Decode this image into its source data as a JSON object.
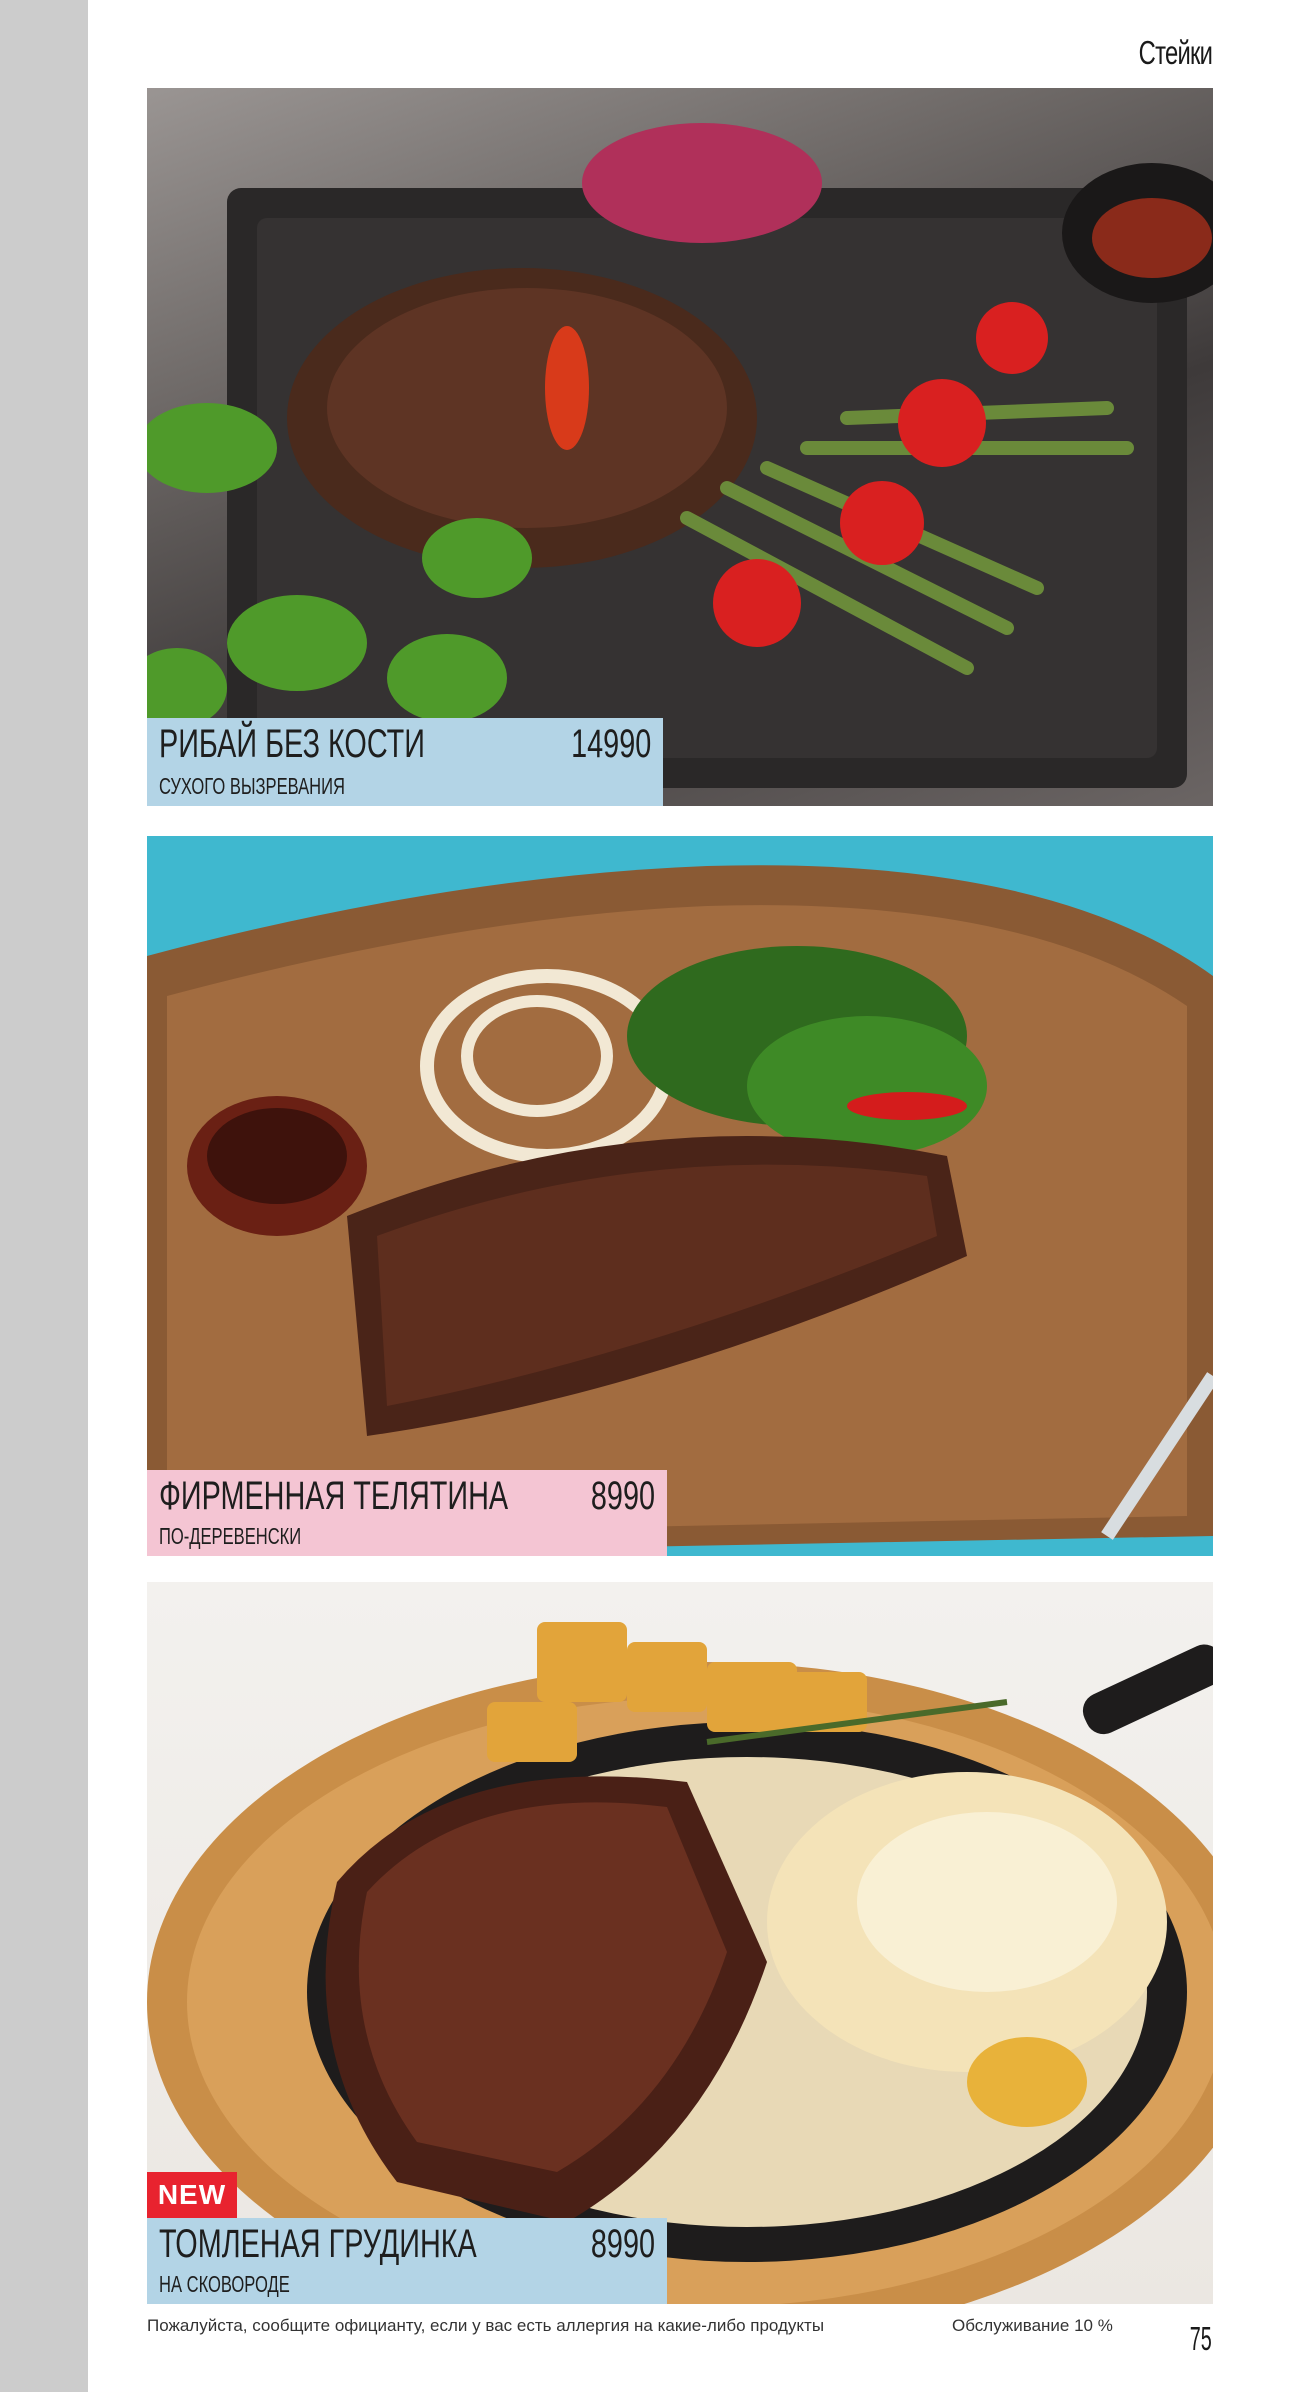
{
  "page": {
    "section_title": "Стейки",
    "page_number": "75"
  },
  "items": [
    {
      "name": "РИБАЙ БЕЗ КОСТИ",
      "subtitle": "СУХОГО ВЫЗРЕВАНИЯ",
      "price": "14990",
      "label_color": "#b3d4e6"
    },
    {
      "name": "ФИРМЕННАЯ ТЕЛЯТИНА",
      "subtitle": "ПО-ДЕРЕВЕНСКИ",
      "price": "8990",
      "label_color": "#f4c5d3"
    },
    {
      "name": "ТОМЛЕНАЯ ГРУДИНКА",
      "subtitle": "НА СКОВОРОДЕ",
      "price": "8990",
      "label_color": "#b3d4e6",
      "badge": "NEW"
    }
  ],
  "footer": {
    "allergy_note": "Пожалуйста, сообщите официанту, если у вас есть аллергия на какие-либо продукты",
    "service_charge": "Обслуживание 10 %"
  },
  "colors": {
    "side_strip": "#cccccc",
    "badge_new": "#e8232f"
  }
}
